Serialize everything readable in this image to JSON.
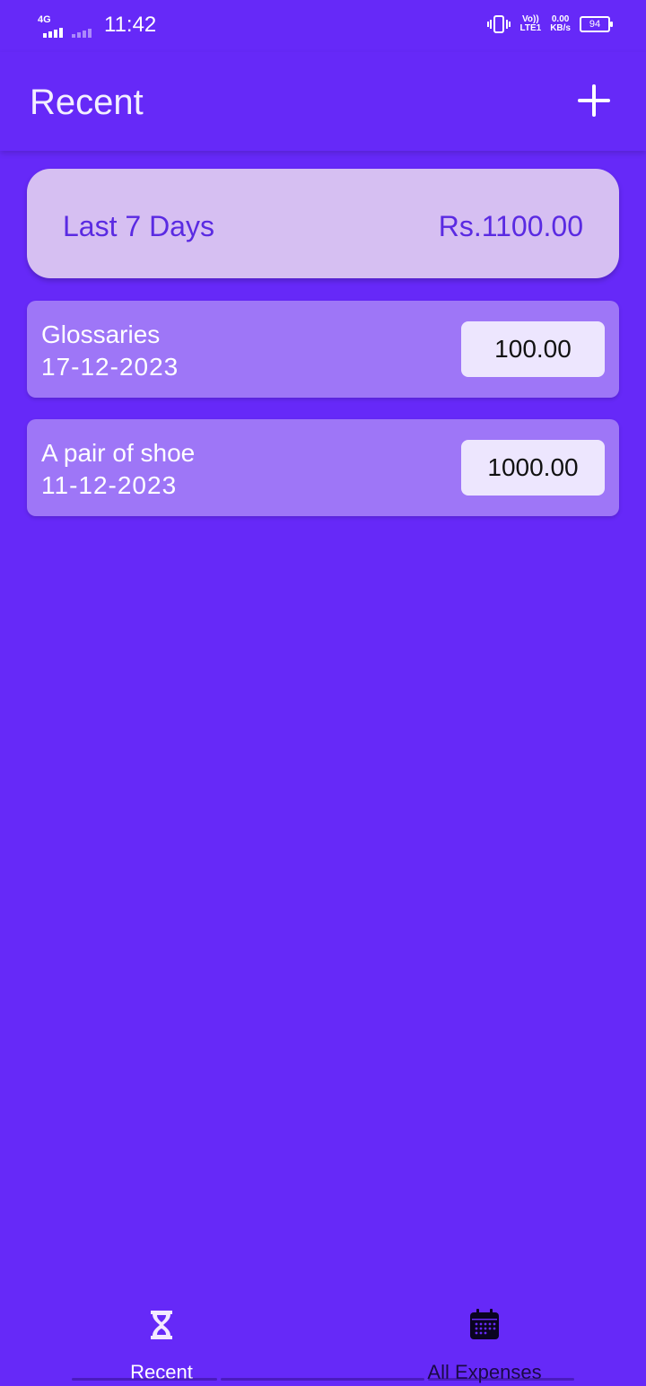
{
  "status_bar": {
    "network_type": "4G",
    "time": "11:42",
    "volte_line1": "Vo))",
    "volte_line2": "LTE1",
    "speed_value": "0.00",
    "speed_unit": "KB/s",
    "battery": "94"
  },
  "app_bar": {
    "title": "Recent",
    "add_icon": "plus-icon"
  },
  "summary": {
    "label": "Last 7 Days",
    "total": "Rs.1100.00"
  },
  "expenses": [
    {
      "title": "Glossaries",
      "date": "17-12-2023",
      "amount": "100.00"
    },
    {
      "title": "A pair of shoe",
      "date": "11-12-2023",
      "amount": "1000.00"
    }
  ],
  "bottom_nav": {
    "items": [
      {
        "label": "Recent",
        "icon": "hourglass-icon",
        "active": true
      },
      {
        "label": "All Expenses",
        "icon": "calendar-icon",
        "active": false
      }
    ]
  },
  "colors": {
    "background": "#6629f8",
    "summary_card": "#d6bff2",
    "summary_text": "#5a2ae2",
    "item_card": "#9e76f7",
    "amount_chip": "#ede6fe"
  }
}
